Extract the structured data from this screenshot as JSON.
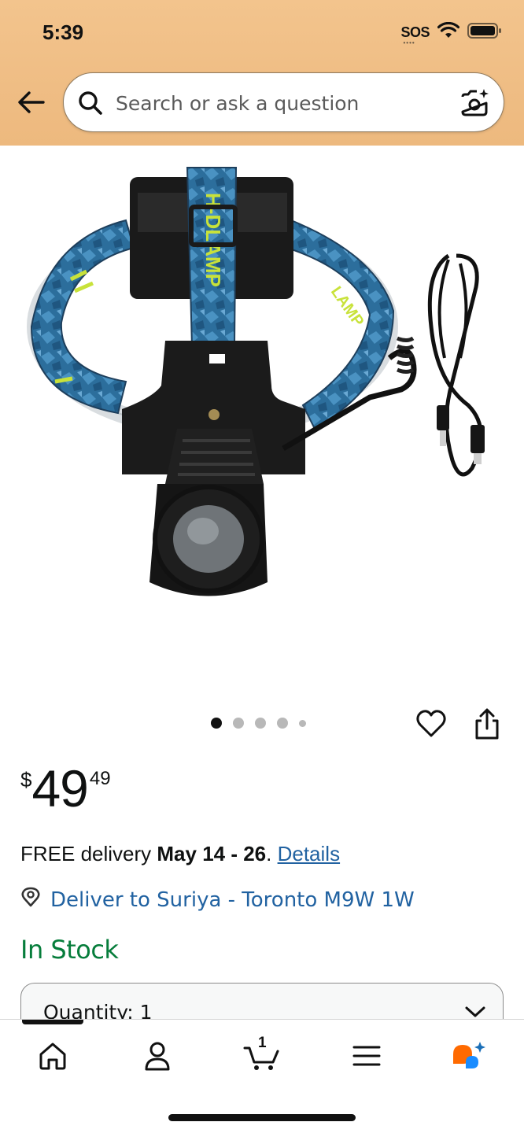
{
  "status_bar": {
    "time": "5:39",
    "sos": "SOS"
  },
  "search": {
    "placeholder": "Search or ask a question"
  },
  "carousel": {
    "total_images": 5,
    "active_index": 0
  },
  "price": {
    "currency": "$",
    "whole": "49",
    "fraction": "49"
  },
  "delivery": {
    "prefix": "FREE delivery ",
    "dates": "May 14 - 26",
    "suffix": ". ",
    "details_link": "Details",
    "location": "Deliver to Suriya - Toronto M9W 1W"
  },
  "stock": {
    "status": "In Stock"
  },
  "quantity": {
    "label": "Quantity: 1"
  },
  "cart": {
    "count": "1"
  },
  "colors": {
    "header_bg": "#f0be84",
    "link": "#2162a1",
    "in_stock": "#067d3b",
    "ai_orange": "#ff6a00",
    "ai_blue": "#1a8cff"
  },
  "icons": {
    "back": "arrow-left-icon",
    "search": "magnifier-icon",
    "camera": "camera-sparkle-icon",
    "wishlist": "heart-icon",
    "share": "share-icon",
    "location": "location-pin-icon",
    "home": "home-icon",
    "account": "person-icon",
    "cart": "cart-icon",
    "menu": "hamburger-icon",
    "rufus": "rufus-ai-icon"
  }
}
